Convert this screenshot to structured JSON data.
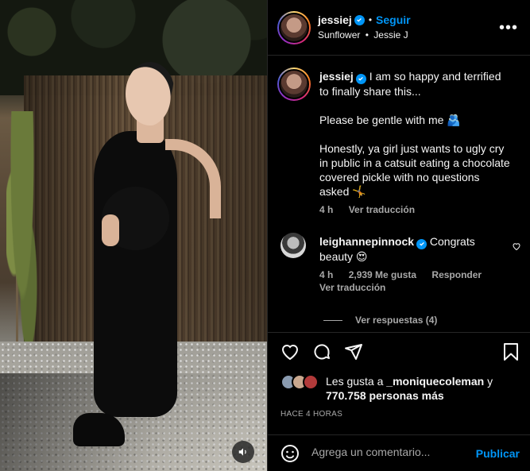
{
  "header": {
    "username": "jessiej",
    "follow_label": "Seguir",
    "dot": "•",
    "audio_title": "Sunflower",
    "audio_sep": "•",
    "audio_artist": "Jessie J",
    "more_label": "•••"
  },
  "caption": {
    "username": "jessiej",
    "line1": "I am so happy and terrified to finally share this...",
    "line2": "Please be gentle with me 🫂",
    "line3": "Honestly, ya girl just wants to ugly cry in public in a catsuit eating a chocolate covered pickle with no questions asked 🤸",
    "time": "4 h",
    "translate": "Ver traducción"
  },
  "comment": {
    "username": "leighannepinnock",
    "text": "Congrats beauty 😍",
    "time": "4 h",
    "likes": "2,939 Me gusta",
    "reply": "Responder",
    "translate": "Ver traducción",
    "view_replies": "Ver respuestas (4)"
  },
  "likes": {
    "prefix": "Les gusta a",
    "user": "_moniquecoleman",
    "connector": "y",
    "count": "770.758 personas más"
  },
  "post_time": "HACE 4 HORAS",
  "comment_input": {
    "placeholder": "Agrega un comentario...",
    "publish": "Publicar"
  },
  "colors": {
    "accent": "#0095f6",
    "background": "#000000",
    "muted": "#a8a8a8"
  },
  "icons": [
    "heart-icon",
    "comment-icon",
    "share-icon",
    "bookmark-icon",
    "emoji-icon",
    "volume-icon",
    "verified-icon",
    "more-icon"
  ]
}
